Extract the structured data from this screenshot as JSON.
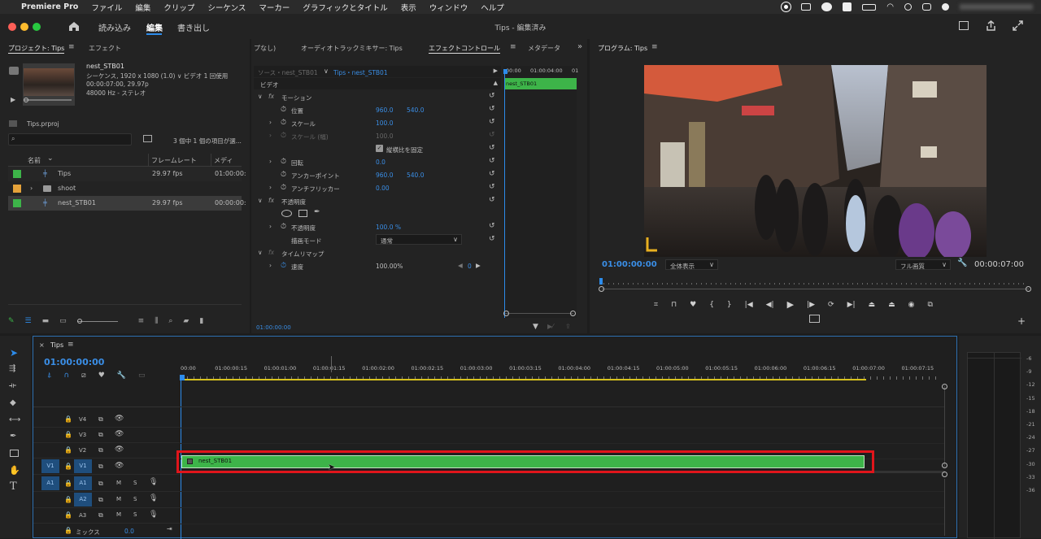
{
  "menubar": {
    "app": "Premiere Pro",
    "items": [
      "ファイル",
      "編集",
      "クリップ",
      "シーケンス",
      "マーカー",
      "グラフィックとタイトル",
      "表示",
      "ウィンドウ",
      "ヘルプ"
    ]
  },
  "titlebar": {
    "tabs": [
      "読み込み",
      "編集",
      "書き出し"
    ],
    "active_tab": "編集",
    "title": "Tips - 編集済み"
  },
  "project": {
    "tab_project": "プロジェクト: Tips",
    "tab_effects": "エフェクト",
    "preview_name": "nest_STB01",
    "preview_info1": "シーケンス, 1920 x 1080 (1.0)  ∨ ビデオ 1 回使用",
    "preview_info2": "00:00:07:00, 29.97p",
    "preview_info3": "48000 Hz - ステレオ",
    "file": "Tips.prproj",
    "count": "3 個中 1 個の項目が選...",
    "col_name": "名前",
    "col_fps": "フレームレート",
    "col_media": "メディア!",
    "rows": [
      {
        "name": "Tips",
        "fps": "29.97 fps",
        "media": "01:00:00:",
        "color": "#3db449",
        "type": "sequence"
      },
      {
        "name": "shoot",
        "fps": "",
        "media": "",
        "color": "#e5a23a",
        "type": "folder"
      },
      {
        "name": "nest_STB01",
        "fps": "29.97 fps",
        "media": "00:00:00:",
        "color": "#3db449",
        "type": "sequence"
      }
    ]
  },
  "effects": {
    "tabs": [
      "プなし)",
      "オーディオトラックミキサー: Tips",
      "エフェクトコントロール",
      "メタデータ"
    ],
    "active_tab": "エフェクトコントロール",
    "source": "ソース・nest_STB01",
    "sequence": "Tips・nest_STB01",
    "section_video": "ビデオ",
    "ruler_start": "00:00",
    "ruler_mid": "01:00:04:00",
    "ruler_end": "01",
    "clip_label": "nest_STB01",
    "motion": "モーション",
    "position": "位置",
    "position_x": "960.0",
    "position_y": "540.0",
    "scale": "スケール",
    "scale_val": "100.0",
    "scale_w": "スケール (幅)",
    "scale_w_val": "100.0",
    "uniform": "縦横比を固定",
    "rotation": "回転",
    "rotation_val": "0.0",
    "anchor": "アンカーポイント",
    "anchor_x": "960.0",
    "anchor_y": "540.0",
    "antiflicker": "アンチフリッカー",
    "antiflicker_val": "0.00",
    "opacity_section": "不透明度",
    "opacity": "不透明度",
    "opacity_val": "100.0 %",
    "blend": "描画モード",
    "blend_val": "通常",
    "timeremap": "タイムリマップ",
    "speed": "速度",
    "speed_val": "100.00%",
    "speed_kf": "0",
    "timecode": "01:00:00:00"
  },
  "program": {
    "tab": "プログラム: Tips",
    "timecode": "01:00:00:00",
    "zoom": "全体表示",
    "quality": "フル画質",
    "duration": "00:00:07:00"
  },
  "timeline": {
    "tab": "Tips",
    "timecode": "01:00:00:00",
    "ruler": [
      "00:00",
      "01:00:00:15",
      "01:00:01:00",
      "01:00:01:15",
      "01:00:02:00",
      "01:00:02:15",
      "01:00:03:00",
      "01:00:03:15",
      "01:00:04:00",
      "01:00:04:15",
      "01:00:05:00",
      "01:00:05:15",
      "01:00:06:00",
      "01:00:06:15",
      "01:00:07:00",
      "01:00:07:15"
    ],
    "video_tracks": [
      "V4",
      "V3",
      "V2",
      "V1"
    ],
    "audio_tracks": [
      "A1",
      "A2",
      "A3"
    ],
    "src_v": "V1",
    "src_a": "A1",
    "mix_label": "ミックス",
    "mix_val": "0.0",
    "clip_name": "nest_STB01",
    "mute": "M",
    "solo": "S"
  },
  "meter": {
    "scale": [
      "-6",
      "-9",
      "-12",
      "-15",
      "-18",
      "-21",
      "-24",
      "-27",
      "-30",
      "-33",
      "-36"
    ]
  },
  "colors": {
    "accent": "#2d8ceb",
    "clip_green": "#3db449",
    "highlight_red": "#e0151b"
  }
}
